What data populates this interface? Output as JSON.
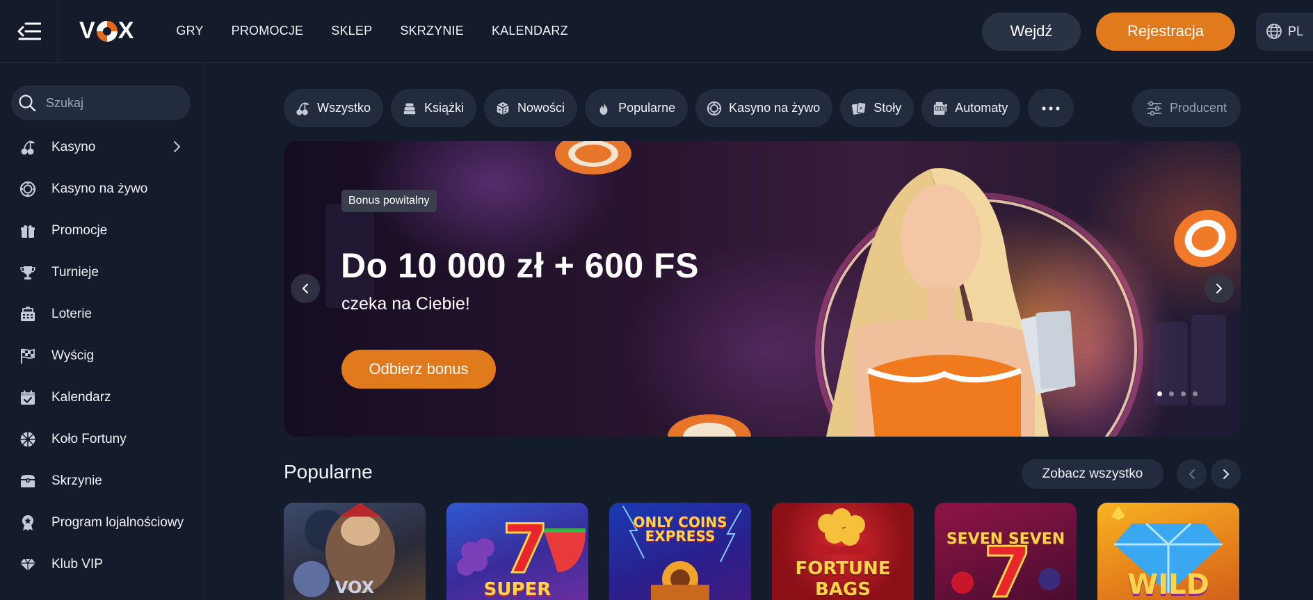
{
  "header": {
    "logo_text": "VOX",
    "nav": [
      "GRY",
      "PROMOCJE",
      "SKLEP",
      "SKRZYNIE",
      "KALENDARZ"
    ],
    "login_label": "Wejdź",
    "register_label": "Rejestracja",
    "language": "PL"
  },
  "sidebar": {
    "search_placeholder": "Szukaj",
    "items": [
      {
        "label": "Kasyno",
        "icon": "cherries-icon"
      },
      {
        "label": "Kasyno na żywo",
        "icon": "chip-icon"
      },
      {
        "label": "Promocje",
        "icon": "gift-icon"
      },
      {
        "label": "Turnieje",
        "icon": "trophy-icon"
      },
      {
        "label": "Loterie",
        "icon": "ticket-icon"
      },
      {
        "label": "Wyścig",
        "icon": "checkered-flag-icon"
      },
      {
        "label": "Kalendarz",
        "icon": "calendar-icon"
      },
      {
        "label": "Koło Fortuny",
        "icon": "wheel-icon"
      },
      {
        "label": "Skrzynie",
        "icon": "chest-icon"
      },
      {
        "label": "Program lojalnościowy",
        "icon": "badge-icon"
      },
      {
        "label": "Klub VIP",
        "icon": "diamond-icon"
      }
    ]
  },
  "filters": {
    "chips": [
      {
        "label": "Wszystko",
        "icon": "cherries-icon"
      },
      {
        "label": "Książki",
        "icon": "books-icon"
      },
      {
        "label": "Nowości",
        "icon": "dice-icon"
      },
      {
        "label": "Popularne",
        "icon": "fire-icon"
      },
      {
        "label": "Kasyno na żywo",
        "icon": "chip-icon"
      },
      {
        "label": "Stoły",
        "icon": "cards-icon"
      },
      {
        "label": "Automaty",
        "icon": "slot-machine-icon"
      }
    ],
    "more": "···",
    "producer_label": "Producent"
  },
  "banner": {
    "badge": "Bonus powitalny",
    "title": "Do 10 000 zł + 600 FS",
    "subtitle": "czeka na Ciebie!",
    "cta": "Odbierz bonus",
    "slides": 4,
    "active_slide": 1
  },
  "popular": {
    "title": "Popularne",
    "see_all": "Zobacz wszystko",
    "games": [
      {
        "label": "VOX",
        "colors": [
          "#2c3e5c",
          "#5a4a3a"
        ]
      },
      {
        "label": "SUPER",
        "colors": [
          "#2a4bb0",
          "#6a2fa0"
        ]
      },
      {
        "label": "ONLY COINS EXPRESS",
        "colors": [
          "#1e3aa8",
          "#3a1f8a"
        ]
      },
      {
        "label": "FORTUNE BAGS",
        "colors": [
          "#b0161f",
          "#5a0b10"
        ]
      },
      {
        "label": "SEVEN SEVEN",
        "colors": [
          "#8a1240",
          "#3a0c2a"
        ]
      },
      {
        "label": "WILD",
        "colors": [
          "#f5a21c",
          "#d9671a"
        ]
      }
    ]
  },
  "colors": {
    "accent": "#e07a1c",
    "background": "#141b2b",
    "surface": "#232c3e"
  }
}
